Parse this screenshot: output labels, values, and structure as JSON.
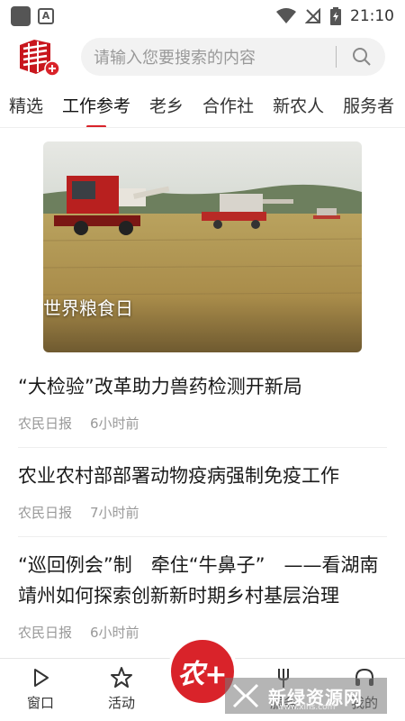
{
  "status_bar": {
    "time": "21:10"
  },
  "search": {
    "placeholder": "请输入您要搜索的内容"
  },
  "tabs": [
    {
      "label": "精选"
    },
    {
      "label": "工作参考"
    },
    {
      "label": "老乡"
    },
    {
      "label": "合作社"
    },
    {
      "label": "新农人"
    },
    {
      "label": "服务者"
    }
  ],
  "active_tab": "工作参考",
  "banner": {
    "caption": "世界粮食日"
  },
  "news": [
    {
      "title": "“大检验”改革助力兽药检测开新局",
      "source": "农民日报",
      "time": "6小时前"
    },
    {
      "title": "农业农村部部署动物疫病强制免疫工作",
      "source": "农民日报",
      "time": "7小时前"
    },
    {
      "title": "“巡回例会”制　牵住“牛鼻子”　——看湖南靖州如何探索创新新时期乡村基层治理",
      "source": "农民日报",
      "time": "6小时前"
    }
  ],
  "bottom_nav": {
    "items": [
      {
        "label": "窗口",
        "icon": "play-icon"
      },
      {
        "label": "活动",
        "icon": "star-icon"
      },
      {
        "label": "服务",
        "icon": "fork-icon"
      },
      {
        "label": "我的",
        "icon": "headset-icon"
      }
    ],
    "center_label": "农+"
  },
  "watermark": {
    "title": "新绿资源网",
    "sub": "www.xlhs.com"
  },
  "colors": {
    "accent": "#d9232a",
    "text": "#222222",
    "muted": "#999999"
  }
}
